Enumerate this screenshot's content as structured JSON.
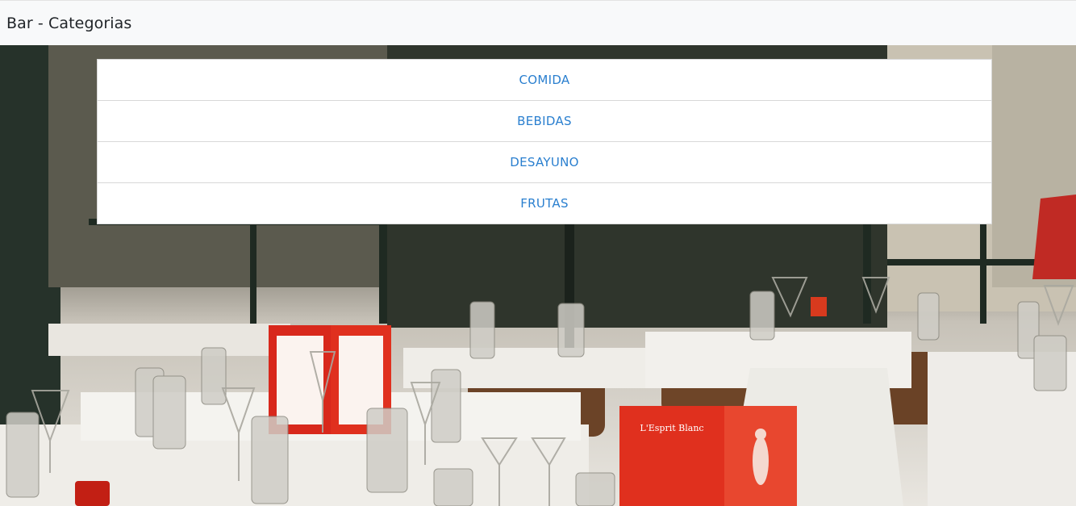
{
  "navbar": {
    "brand": "Bar - Categorias"
  },
  "categories": [
    {
      "label": "COMIDA"
    },
    {
      "label": "BEBIDAS"
    },
    {
      "label": "DESAYUNO"
    },
    {
      "label": "FRUTAS"
    }
  ],
  "hero": {
    "menu_card_text": "L'Esprit Blanc",
    "colors": {
      "tablecloth": "#f2f0ec",
      "menu_red": "#e0301e",
      "wood": "#6b4327",
      "frame": "#1f2a22"
    }
  },
  "colors": {
    "link": "#2a7fcf",
    "navbar_bg": "#f8f9fa"
  }
}
